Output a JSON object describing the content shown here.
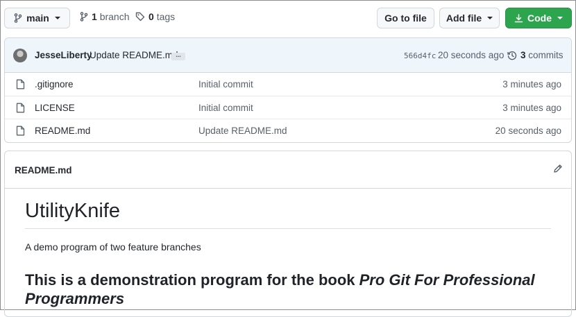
{
  "toolbar": {
    "branch_label": "main",
    "branch_count": "1",
    "branch_word": "branch",
    "tag_count": "0",
    "tag_word": "tags",
    "go_to_file": "Go to file",
    "add_file": "Add file",
    "code": "Code",
    "code_color": "#2da44e"
  },
  "commit": {
    "author": "JesseLiberty",
    "message": "Update README.md",
    "ellipsis": "...",
    "sha": "566d4fc",
    "time": "20 seconds ago",
    "count": "3",
    "count_word": "commits"
  },
  "files": [
    {
      "name": ".gitignore",
      "commit": "Initial commit",
      "age": "3 minutes ago",
      "icon": "file-icon"
    },
    {
      "name": "LICENSE",
      "commit": "Initial commit",
      "age": "3 minutes ago",
      "icon": "file-icon"
    },
    {
      "name": "README.md",
      "commit": "Update README.md",
      "age": "20 seconds ago",
      "icon": "file-icon"
    }
  ],
  "readme": {
    "filename": "README.md",
    "heading": "UtilityKnife",
    "description": "A demo program of two feature branches",
    "subheading_plain": "This is a demonstration program for the book ",
    "subheading_italic": "Pro Git For Professional Programmers"
  }
}
